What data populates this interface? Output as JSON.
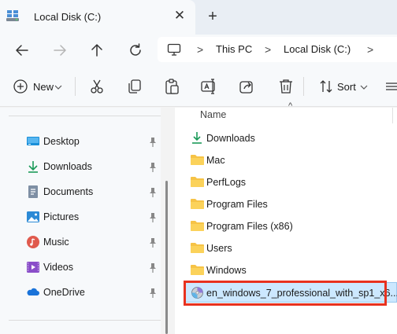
{
  "tab": {
    "title": "Local Disk (C:)",
    "close_glyph": "✕",
    "new_tab_glyph": "+"
  },
  "address": {
    "crumbs": [
      "This PC",
      "Local Disk (C:)"
    ],
    "separator": ">"
  },
  "toolbar": {
    "new_label": "New",
    "sort_label": "Sort"
  },
  "sidebar": {
    "items": [
      {
        "label": "Desktop",
        "icon": "desktop-icon",
        "pinned": true
      },
      {
        "label": "Downloads",
        "icon": "downloads-icon",
        "pinned": true
      },
      {
        "label": "Documents",
        "icon": "documents-icon",
        "pinned": true
      },
      {
        "label": "Pictures",
        "icon": "pictures-icon",
        "pinned": true
      },
      {
        "label": "Music",
        "icon": "music-icon",
        "pinned": true
      },
      {
        "label": "Videos",
        "icon": "videos-icon",
        "pinned": true
      },
      {
        "label": "OneDrive",
        "icon": "onedrive-icon",
        "pinned": true
      }
    ]
  },
  "files": {
    "column_name": "Name",
    "rows": [
      {
        "label": "Downloads",
        "icon": "downloads-icon"
      },
      {
        "label": "Mac",
        "icon": "folder-icon"
      },
      {
        "label": "PerfLogs",
        "icon": "folder-icon"
      },
      {
        "label": "Program Files",
        "icon": "folder-icon"
      },
      {
        "label": "Program Files (x86)",
        "icon": "folder-icon"
      },
      {
        "label": "Users",
        "icon": "folder-icon"
      },
      {
        "label": "Windows",
        "icon": "folder-icon"
      },
      {
        "label": "en_windows_7_professional_with_sp1_x6...",
        "icon": "disc-image-icon",
        "selected": true
      }
    ]
  },
  "colors": {
    "accent": "#0067c0",
    "folder": "#f6c346",
    "selection": "#cce8ff",
    "highlight_border": "#e8321f"
  }
}
